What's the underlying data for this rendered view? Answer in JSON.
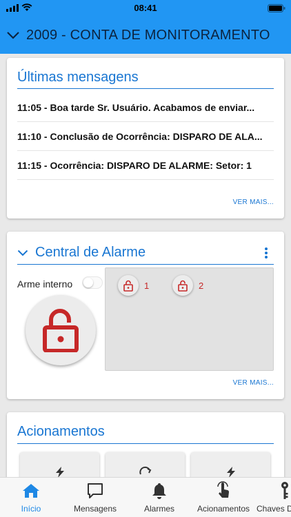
{
  "status_bar": {
    "time": "08:41"
  },
  "header": {
    "title": "2009 - CONTA DE MONITORAMENTO"
  },
  "messages": {
    "title": "Últimas mensagens",
    "items": [
      "11:05 - Boa tarde Sr. Usuário. Acabamos de enviar...",
      "11:10 - Conclusão de Ocorrência: DISPARO DE ALA...",
      "11:15 - Ocorrência: DISPARO DE ALARME: Setor: 1"
    ],
    "more_label": "VER MAIS..."
  },
  "alarm": {
    "title": "Central de Alarme",
    "internal_arm_label": "Arme interno",
    "internal_arm_on": false,
    "zones": [
      {
        "label": "1"
      },
      {
        "label": "2"
      }
    ],
    "more_label": "VER MAIS..."
  },
  "actions": {
    "title": "Acionamentos"
  },
  "tabs": [
    {
      "label": "Início",
      "icon": "home-icon",
      "active": true
    },
    {
      "label": "Mensagens",
      "icon": "chat-bubble-icon",
      "active": false
    },
    {
      "label": "Alarmes",
      "icon": "bell-icon",
      "active": false
    },
    {
      "label": "Acionamentos",
      "icon": "touch-icon",
      "active": false
    },
    {
      "label": "Chaves D",
      "icon": "key-icon",
      "active": false
    }
  ],
  "colors": {
    "primary": "#2196f3",
    "accent": "#1976d2",
    "lock_red": "#c62828"
  }
}
